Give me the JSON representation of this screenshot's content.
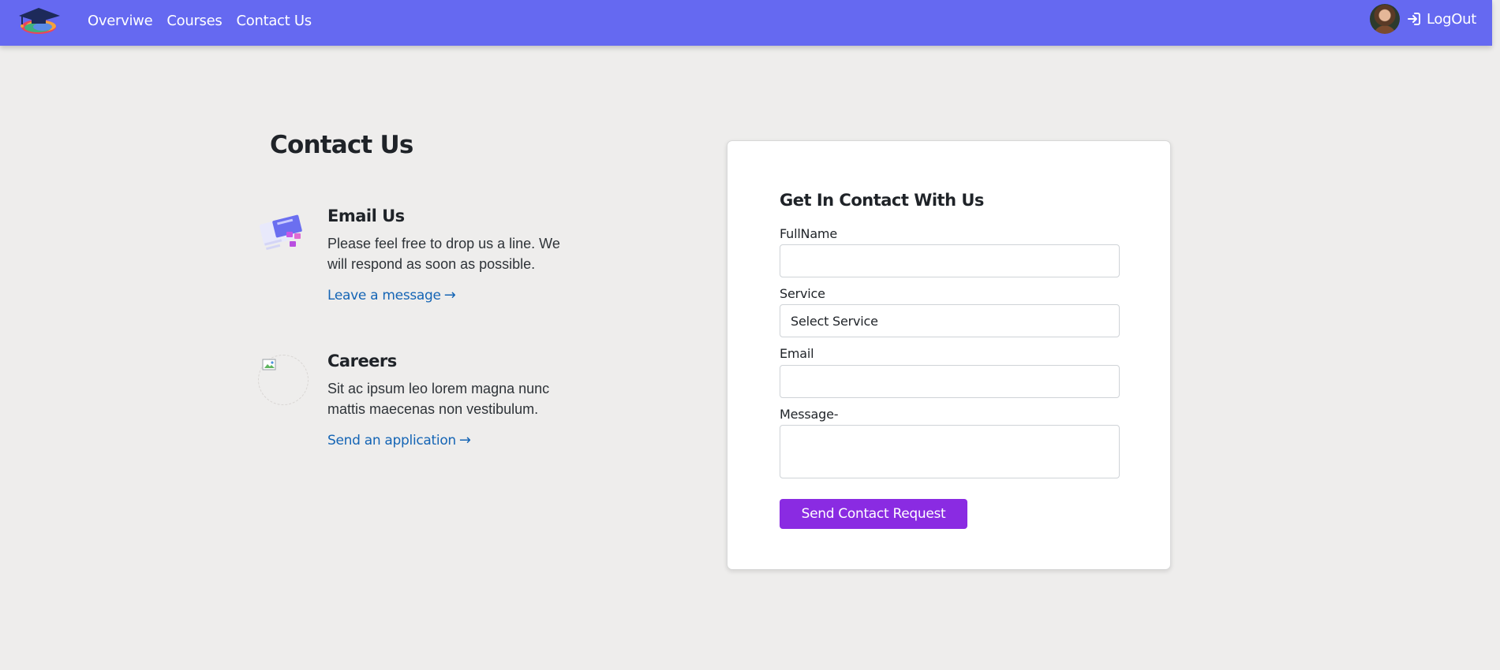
{
  "nav": {
    "links": [
      "Overviwe",
      "Courses",
      "Contact Us"
    ],
    "logout_label": "LogOut",
    "brand_color": "#6569f1"
  },
  "page": {
    "title": "Contact Us"
  },
  "info": {
    "email": {
      "title": "Email Us",
      "text": "Please feel free to drop us a line. We will respond as soon as possible.",
      "link": "Leave a message"
    },
    "careers": {
      "title": "Careers",
      "text": "Sit ac ipsum leo lorem magna nunc mattis maecenas non vestibulum.",
      "link": "Send an application"
    }
  },
  "form": {
    "title": "Get In Contact With Us",
    "fullname_label": "FullName",
    "fullname_value": "",
    "service_label": "Service",
    "service_selected": "Select Service",
    "email_label": "Email",
    "email_value": "",
    "message_label": "Message-",
    "message_value": "",
    "submit_label": "Send Contact Request",
    "accent_color": "#8a2be2"
  },
  "icons": {
    "logo": "graduation-cap-logo",
    "logout": "sign-in-arrow-icon",
    "link_arrow": "arrow-right-icon"
  }
}
